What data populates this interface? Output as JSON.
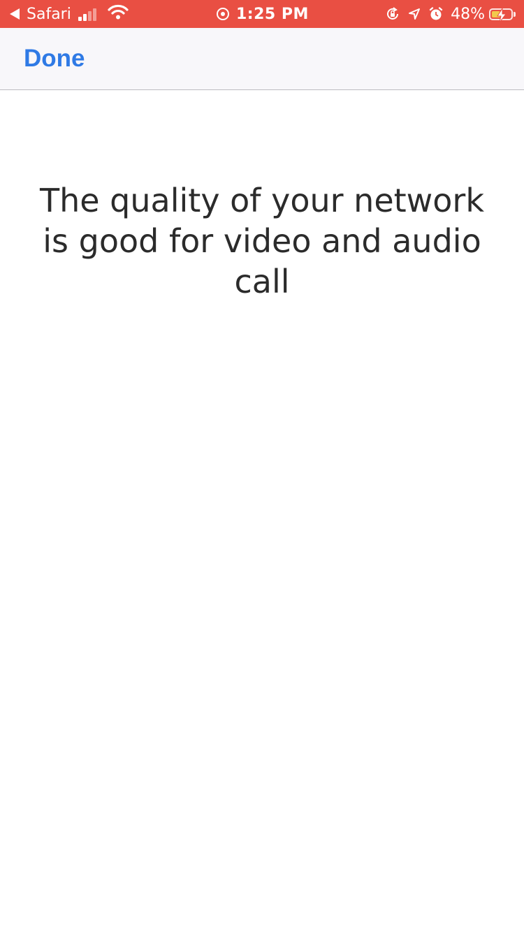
{
  "status_bar": {
    "back_app_label": "Safari",
    "time": "1:25 PM",
    "battery_percent": "48%",
    "battery_level": 0.48,
    "signal_bars_active": 2,
    "signal_bars_total": 4,
    "background_color": "#e94f43",
    "icons": [
      "back-arrow-icon",
      "cellular-signal-icon",
      "wifi-icon",
      "screen-recording-icon",
      "orientation-lock-icon",
      "location-arrow-icon",
      "alarm-icon",
      "battery-charging-icon"
    ]
  },
  "nav_bar": {
    "done_label": "Done",
    "accent_color": "#2f7ae5"
  },
  "content": {
    "message_lines": [
      "The quality of your network",
      "is good for video and audio",
      "call"
    ]
  }
}
